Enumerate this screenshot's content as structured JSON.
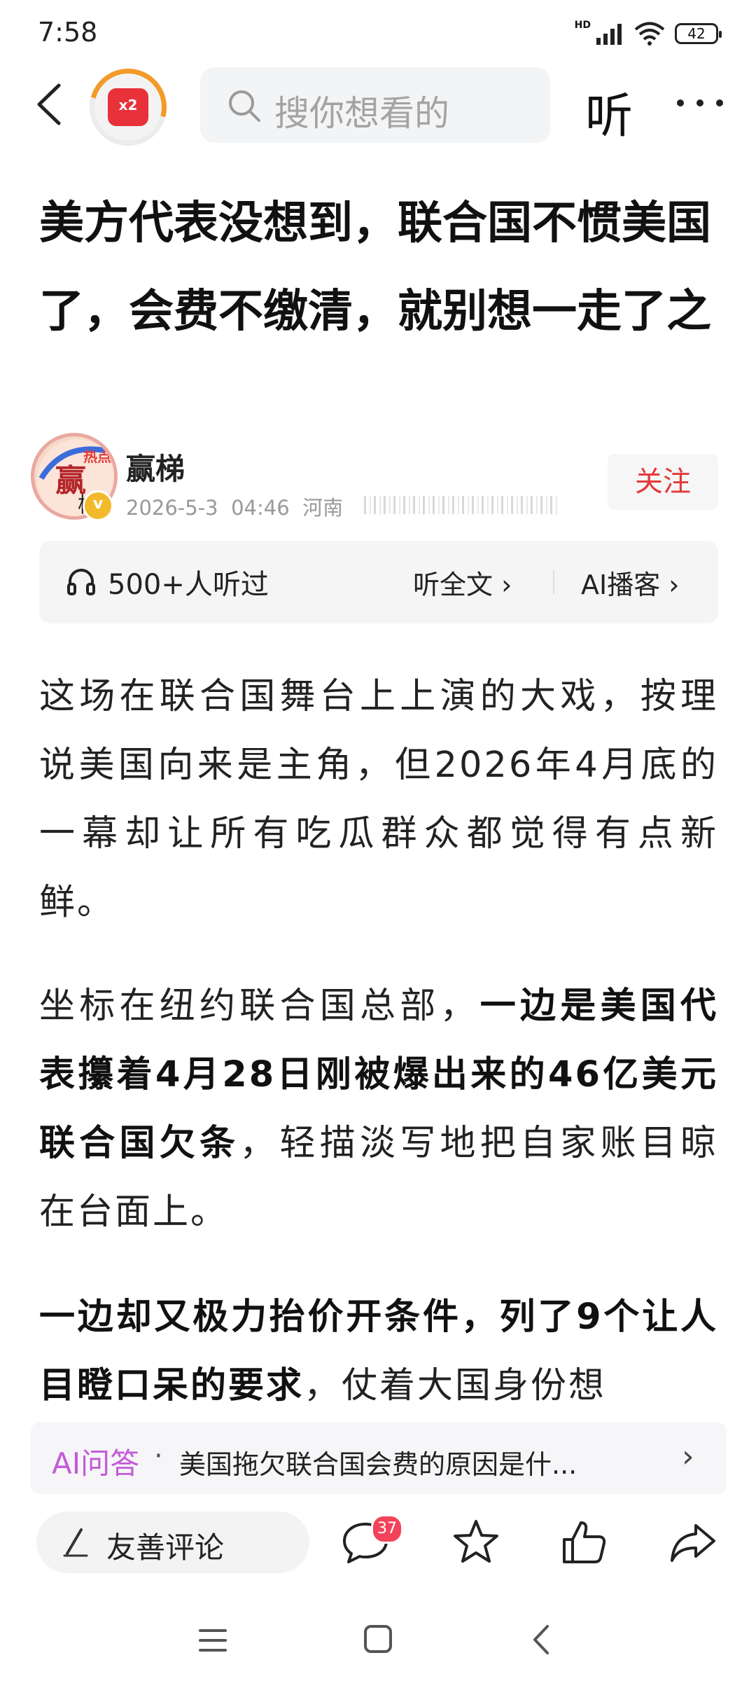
{
  "status_bar": {
    "time": "7:58",
    "network": "HD",
    "battery": "42"
  },
  "nav": {
    "badge_text": "x2",
    "search_placeholder": "搜你想看的",
    "listen_label": "听"
  },
  "article": {
    "title": "美方代表没想到，联合国不惯美国了，会费不缴清，就别想一走了之",
    "author": {
      "name": "赢梯",
      "date": "2026-5-3",
      "time": "04:46",
      "location": "河南",
      "follow_label": "关注"
    },
    "listen_bar": {
      "count": "500+人听过",
      "full_text_label": "听全文 ›",
      "podcast_label": "AI播客 ›"
    },
    "paragraphs": [
      {
        "text": "这场在联合国舞台上上演的大戏，按理说美国向来是主角，但2026年4月底的一幕却让所有吃瓜群众都觉得有点新鲜。"
      },
      {
        "prefix": "坐标在纽约联合国总部，",
        "bold": "一边是美国代表攥着4月28日刚被爆出来的46亿美元联合国欠条",
        "suffix": "，轻描淡写地把自家账目晾在台面上。"
      },
      {
        "bold": "一边却又极力抬价开条件，列了9个让人目瞪口呆的要求",
        "suffix": "，仗着大国身份想"
      }
    ]
  },
  "ai_qa": {
    "label": "AI问答",
    "separator": "·",
    "question": "美国拖欠联合国会费的原因是什...",
    "arrow": "›"
  },
  "actions": {
    "comment_placeholder": "友善评论",
    "comment_count": "37"
  }
}
